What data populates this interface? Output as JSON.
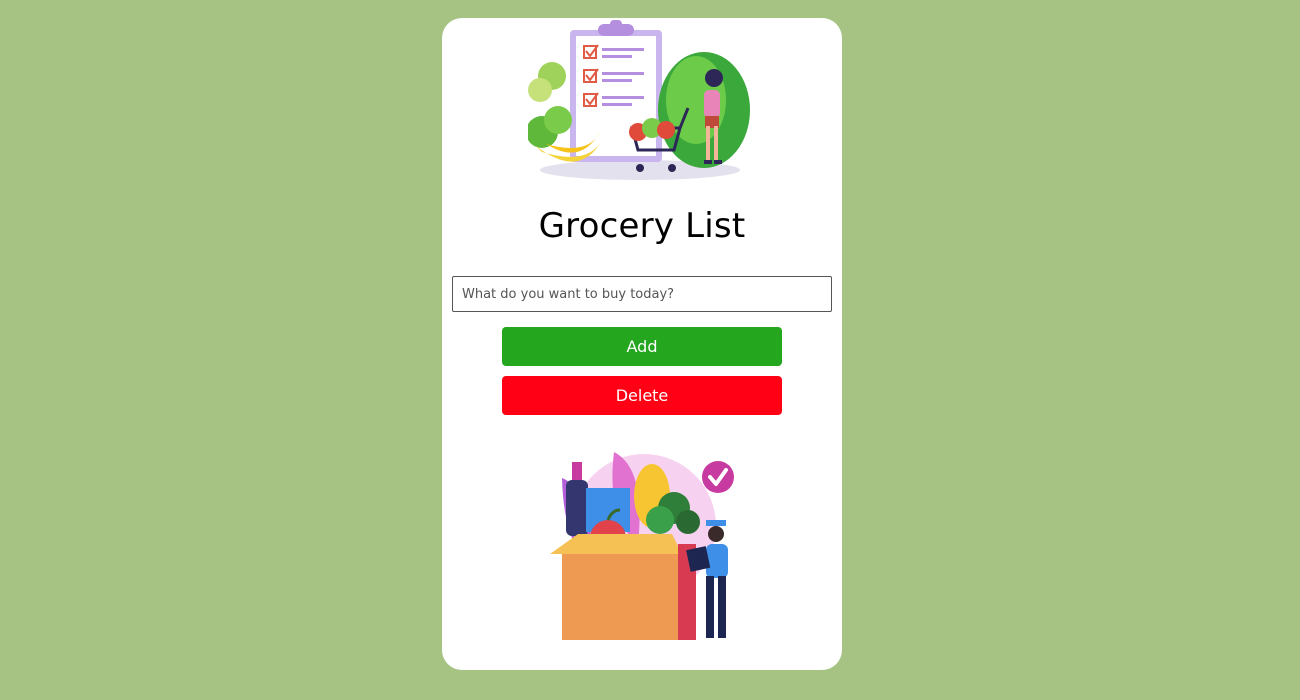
{
  "app": {
    "title": "Grocery List"
  },
  "form": {
    "input_value": "",
    "input_placeholder": "What do you want to buy today?",
    "add_label": "Add",
    "delete_label": "Delete"
  },
  "colors": {
    "background": "#a7c384",
    "card": "#ffffff",
    "add_button": "#25a61f",
    "delete_button": "#ff0015"
  },
  "images": {
    "hero": "grocery-shopping-illustration",
    "footer": "grocery-delivery-box-illustration"
  }
}
